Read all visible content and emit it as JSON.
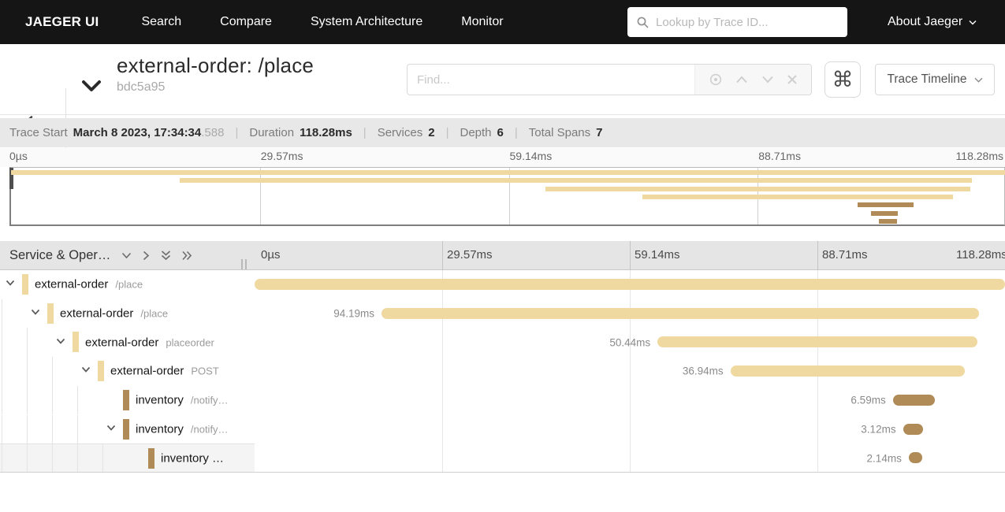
{
  "nav": {
    "brand": "JAEGER UI",
    "items": [
      "Search",
      "Compare",
      "System Architecture",
      "Monitor"
    ],
    "trace_lookup_placeholder": "Lookup by Trace ID...",
    "about_label": "About Jaeger"
  },
  "header": {
    "title": "external-order: /place",
    "trace_id": "bdc5a95",
    "find_placeholder": "Find...",
    "view_selector_label": "Trace Timeline",
    "shortcut_glyph": "⌘"
  },
  "summary": {
    "items": [
      {
        "label": "Trace Start",
        "value": "March 8 2023, 17:34:34",
        "suffix": ".588"
      },
      {
        "label": "Duration",
        "value": "118.28ms",
        "suffix": ""
      },
      {
        "label": "Services",
        "value": "2",
        "suffix": ""
      },
      {
        "label": "Depth",
        "value": "6",
        "suffix": ""
      },
      {
        "label": "Total Spans",
        "value": "7",
        "suffix": ""
      }
    ]
  },
  "timeline": {
    "left_header": "Service & Oper…",
    "ticks_ms": [
      0,
      29.57,
      59.14,
      88.71,
      118.28
    ],
    "tick_labels": [
      "0µs",
      "29.57ms",
      "59.14ms",
      "88.71ms",
      "118.28ms"
    ],
    "total_ms": 118.28
  },
  "colors": {
    "external-order": "#f0d9a0",
    "inventory": "#b08b57",
    "nav_bg": "#151515",
    "summary_bg": "#e8e8e8"
  },
  "spans": [
    {
      "service": "external-order",
      "operation": "/place",
      "depth": 0,
      "start_ms": 0,
      "duration_ms": 118.28,
      "duration_label": "",
      "color": "external-order",
      "expandable": true,
      "highlighted": false
    },
    {
      "service": "external-order",
      "operation": "/place",
      "depth": 1,
      "start_ms": 20.0,
      "duration_ms": 94.19,
      "duration_label": "94.19ms",
      "color": "external-order",
      "expandable": true,
      "highlighted": false
    },
    {
      "service": "external-order",
      "operation": "placeorder",
      "depth": 2,
      "start_ms": 63.5,
      "duration_ms": 50.44,
      "duration_label": "50.44ms",
      "color": "external-order",
      "expandable": true,
      "highlighted": false
    },
    {
      "service": "external-order",
      "operation": "POST",
      "depth": 3,
      "start_ms": 75.0,
      "duration_ms": 36.94,
      "duration_label": "36.94ms",
      "color": "external-order",
      "expandable": true,
      "highlighted": false
    },
    {
      "service": "inventory",
      "operation": "/notify…",
      "depth": 4,
      "start_ms": 100.6,
      "duration_ms": 6.59,
      "duration_label": "6.59ms",
      "color": "inventory",
      "expandable": false,
      "highlighted": false
    },
    {
      "service": "inventory",
      "operation": "/notify…",
      "depth": 4,
      "start_ms": 102.2,
      "duration_ms": 3.12,
      "duration_label": "3.12ms",
      "color": "inventory",
      "expandable": true,
      "highlighted": false
    },
    {
      "service": "inventory …",
      "operation": "",
      "depth": 5,
      "start_ms": 103.1,
      "duration_ms": 2.14,
      "duration_label": "2.14ms",
      "color": "inventory",
      "expandable": false,
      "highlighted": true
    }
  ]
}
